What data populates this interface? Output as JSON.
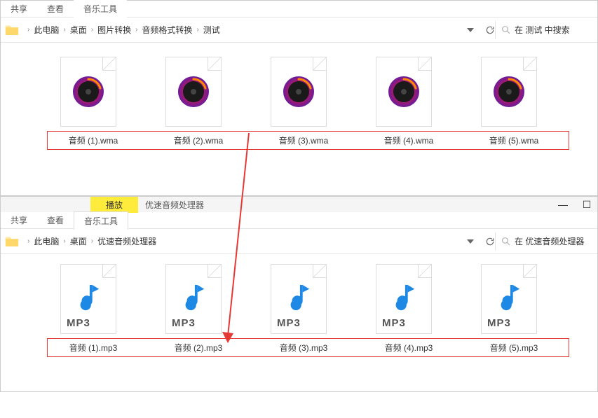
{
  "window1": {
    "tabs": {
      "share": "共享",
      "view": "查看",
      "music_tools": "音乐工具"
    },
    "breadcrumbs": [
      "此电脑",
      "桌面",
      "图片转换",
      "音频格式转换",
      "测试"
    ],
    "search_placeholder": "在 测试 中搜索",
    "files": [
      {
        "name": "音频 (1).wma"
      },
      {
        "name": "音频 (2).wma"
      },
      {
        "name": "音频 (3).wma"
      },
      {
        "name": "音频 (4).wma"
      },
      {
        "name": "音频 (5).wma"
      }
    ]
  },
  "window2": {
    "play_header": {
      "play": "播放",
      "app": "优速音频处理器"
    },
    "tabs": {
      "share": "共享",
      "view": "查看",
      "music_tools": "音乐工具"
    },
    "breadcrumbs": [
      "此电脑",
      "桌面",
      "优速音频处理器"
    ],
    "search_placeholder": "在 优速音频处理器",
    "files": [
      {
        "name": "音频 (1).mp3"
      },
      {
        "name": "音频 (2).mp3"
      },
      {
        "name": "音频 (3).mp3"
      },
      {
        "name": "音频 (4).mp3"
      },
      {
        "name": "音频 (5).mp3"
      }
    ],
    "mp3_label": "MP3",
    "controls": {
      "min": "—",
      "max": "☐"
    }
  }
}
